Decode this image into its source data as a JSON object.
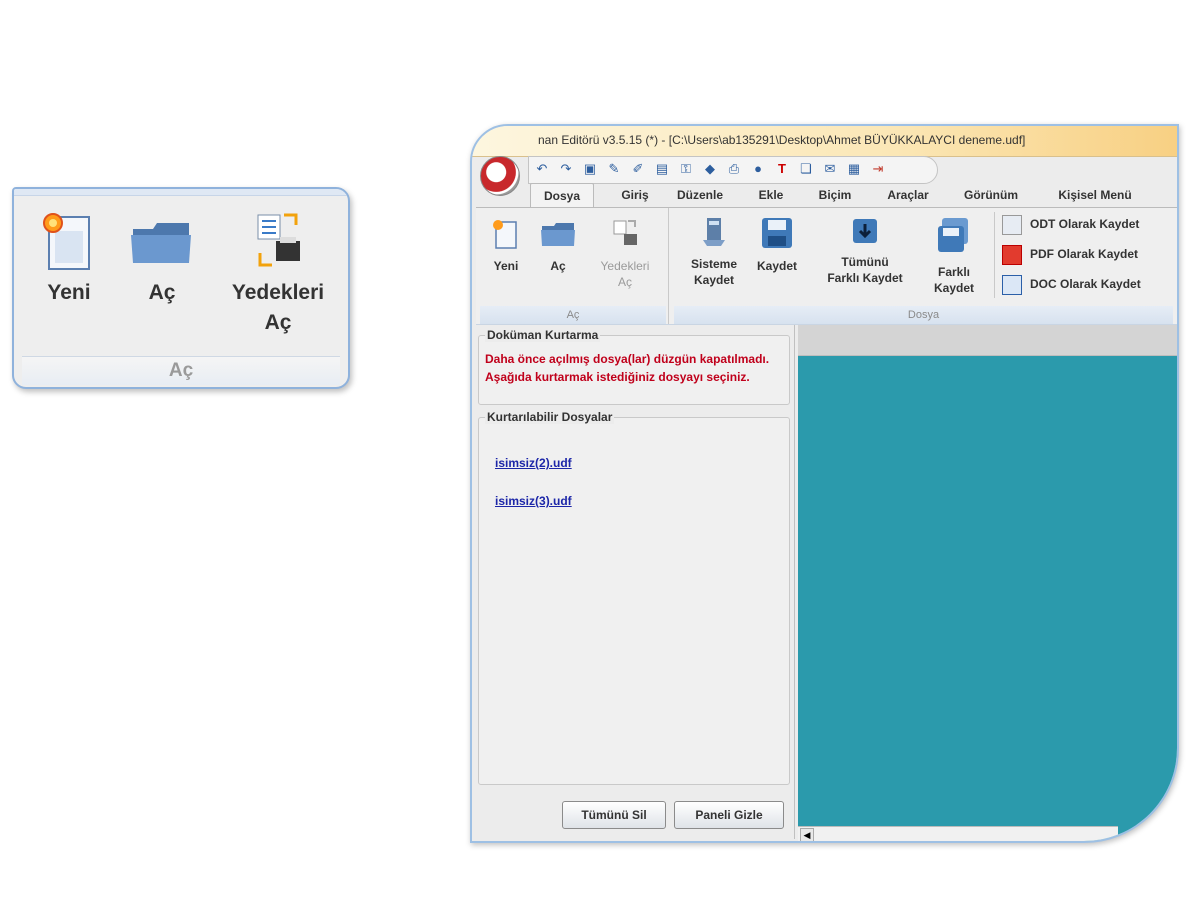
{
  "zoom_panel": {
    "buttons": [
      {
        "label": "Yeni",
        "icon": "new-document-icon"
      },
      {
        "label": "Aç",
        "icon": "folder-open-icon"
      },
      {
        "label_line1": "Yedekleri",
        "label_line2": "Aç",
        "icon": "backup-open-icon"
      }
    ],
    "group_label": "Aç"
  },
  "window": {
    "title": "nan Editörü v3.5.15 (*) - [C:\\Users\\ab135291\\Desktop\\Ahmet BÜYÜKKALAYCI deneme.udf]",
    "quick_access_icons": [
      "undo-icon",
      "redo-icon",
      "save-icon",
      "pen-icon",
      "edit-icon",
      "doc-icon",
      "key-icon",
      "shapes-icon",
      "print-icon",
      "record-icon",
      "text-icon",
      "paste-icon",
      "mail-icon",
      "table-icon",
      "exit-icon"
    ],
    "tabs": [
      "Dosya",
      "Giriş",
      "Düzenle",
      "Ekle",
      "Biçim",
      "Araçlar",
      "Görünüm",
      "Kişisel Menü"
    ],
    "active_tab": "Dosya"
  },
  "ribbon": {
    "ac_group": {
      "label": "Aç",
      "yeni": "Yeni",
      "ac": "Aç",
      "yedekleri_line1": "Yedekleri",
      "yedekleri_line2": "Aç"
    },
    "dosya_group": {
      "label": "Dosya",
      "sisteme_line1": "Sisteme",
      "sisteme_line2": "Kaydet",
      "kaydet": "Kaydet",
      "tumunu_line1": "Tümünü",
      "tumunu_line2": "Farklı Kaydet",
      "farkli_line1": "Farklı",
      "farkli_line2": "Kaydet",
      "odt": "ODT Olarak Kaydet",
      "pdf": "PDF Olarak Kaydet",
      "doc": "DOC Olarak Kaydet"
    }
  },
  "recovery": {
    "title": "Doküman Kurtarma",
    "warning_line1": "Daha önce açılmış dosya(lar) düzgün kapatılmadı.",
    "warning_line2": "Aşağıda kurtarmak istediğiniz dosyayı seçiniz.",
    "files_title": "Kurtarılabilir Dosyalar",
    "files": [
      "isimsiz(2).udf",
      "isimsiz(3).udf"
    ],
    "delete_all": "Tümünü Sil",
    "hide_panel": "Paneli Gizle"
  },
  "colors": {
    "document_bg": "#2b9aac",
    "warning_text": "#c0001b",
    "link_text": "#1c26a8"
  }
}
